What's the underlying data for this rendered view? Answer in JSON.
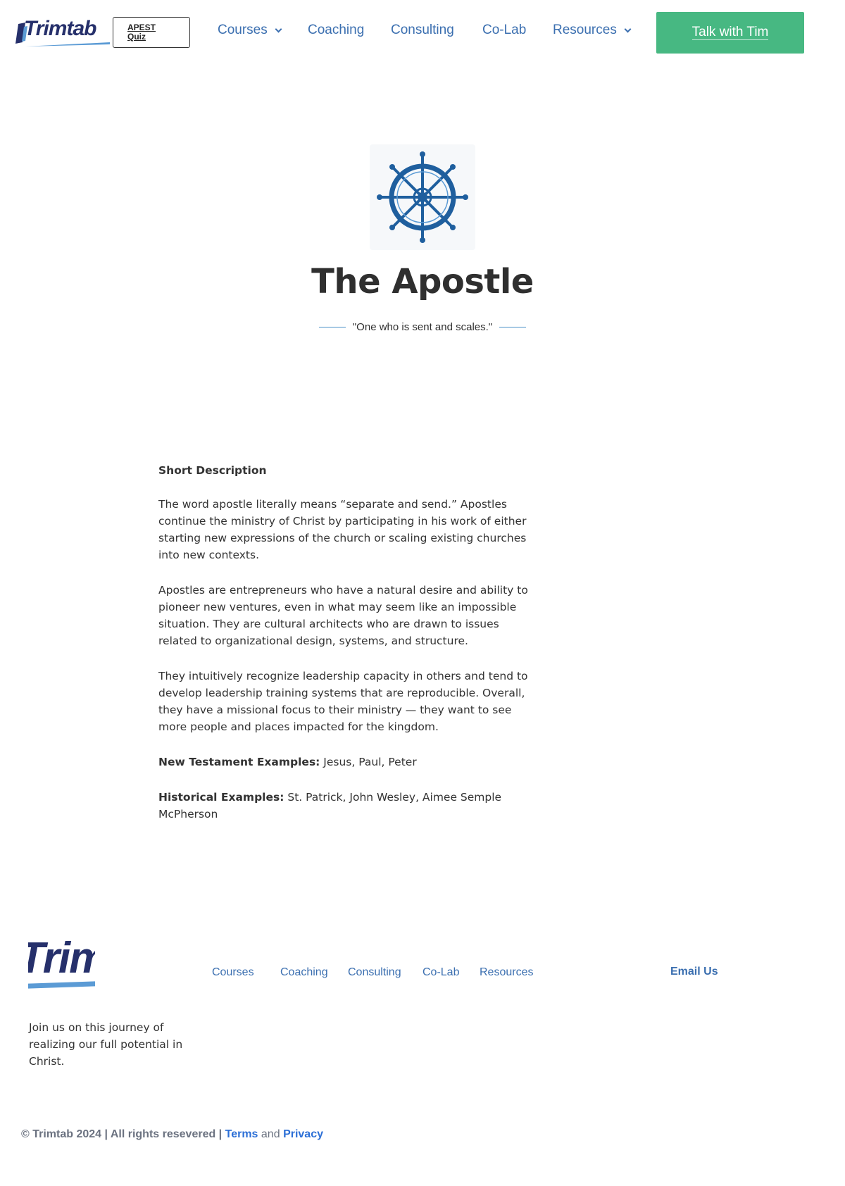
{
  "header": {
    "logo_text": "Trimtab",
    "quiz_label": "APEST Quiz",
    "nav": [
      {
        "label": "Courses",
        "dropdown": true
      },
      {
        "label": "Coaching",
        "dropdown": false
      },
      {
        "label": "Consulting",
        "dropdown": false
      },
      {
        "label": "Co-Lab",
        "dropdown": false
      },
      {
        "label": "Resources",
        "dropdown": true
      }
    ],
    "cta_label": "Talk with Tim"
  },
  "hero": {
    "icon": "ships-wheel-icon",
    "title": "The Apostle",
    "tagline": "\"One who is sent and scales.\""
  },
  "content": {
    "heading": "Short Description",
    "paragraphs": [
      "The word apostle literally means “separate and send.” Apostles continue the ministry of Christ by participating in his work of either starting new expressions of the church or scaling existing churches into new contexts.",
      "Apostles are entrepreneurs who have a natural desire and ability to pioneer new ventures, even in what may seem like an impossible situation. They are cultural architects who are drawn to issues related to organizational design, systems, and structure.",
      "They intuitively recognize leadership capacity in others and tend to develop leadership training systems that are reproducible. Overall, they have a missional focus to their ministry — they want to see more people and places impacted for the kingdom."
    ],
    "nt_label": "New Testament Examples:",
    "nt_value": " Jesus, Paul, Peter",
    "hist_label": "Historical Examples:",
    "hist_value": " St. Patrick, John Wesley, Aimee Semple McPherson"
  },
  "footer": {
    "logo_text": "Trim",
    "nav": [
      "Courses",
      "Coaching",
      "Consulting",
      "Co-Lab",
      "Resources"
    ],
    "email_label": "Email Us",
    "join_text": "Join us on this journey of realizing our full potential in Christ.",
    "copyright": "© Trimtab 2024 | All rights resevered |",
    "terms_label": "Terms",
    "and_text": "and",
    "privacy_label": "Privacy"
  },
  "colors": {
    "brand_navy": "#26306b",
    "link_blue": "#3b6fb0",
    "cta_green": "#47b882",
    "wheel_blue": "#1f5f9e"
  }
}
